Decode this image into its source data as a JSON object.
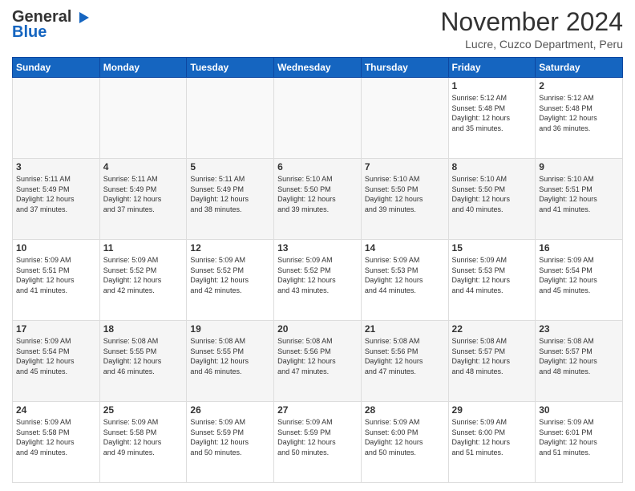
{
  "header": {
    "logo_line1": "General",
    "logo_line2": "Blue",
    "month_title": "November 2024",
    "location": "Lucre, Cuzco Department, Peru"
  },
  "days_of_week": [
    "Sunday",
    "Monday",
    "Tuesday",
    "Wednesday",
    "Thursday",
    "Friday",
    "Saturday"
  ],
  "weeks": [
    [
      {
        "day": "",
        "info": ""
      },
      {
        "day": "",
        "info": ""
      },
      {
        "day": "",
        "info": ""
      },
      {
        "day": "",
        "info": ""
      },
      {
        "day": "",
        "info": ""
      },
      {
        "day": "1",
        "info": "Sunrise: 5:12 AM\nSunset: 5:48 PM\nDaylight: 12 hours\nand 35 minutes."
      },
      {
        "day": "2",
        "info": "Sunrise: 5:12 AM\nSunset: 5:48 PM\nDaylight: 12 hours\nand 36 minutes."
      }
    ],
    [
      {
        "day": "3",
        "info": "Sunrise: 5:11 AM\nSunset: 5:49 PM\nDaylight: 12 hours\nand 37 minutes."
      },
      {
        "day": "4",
        "info": "Sunrise: 5:11 AM\nSunset: 5:49 PM\nDaylight: 12 hours\nand 37 minutes."
      },
      {
        "day": "5",
        "info": "Sunrise: 5:11 AM\nSunset: 5:49 PM\nDaylight: 12 hours\nand 38 minutes."
      },
      {
        "day": "6",
        "info": "Sunrise: 5:10 AM\nSunset: 5:50 PM\nDaylight: 12 hours\nand 39 minutes."
      },
      {
        "day": "7",
        "info": "Sunrise: 5:10 AM\nSunset: 5:50 PM\nDaylight: 12 hours\nand 39 minutes."
      },
      {
        "day": "8",
        "info": "Sunrise: 5:10 AM\nSunset: 5:50 PM\nDaylight: 12 hours\nand 40 minutes."
      },
      {
        "day": "9",
        "info": "Sunrise: 5:10 AM\nSunset: 5:51 PM\nDaylight: 12 hours\nand 41 minutes."
      }
    ],
    [
      {
        "day": "10",
        "info": "Sunrise: 5:09 AM\nSunset: 5:51 PM\nDaylight: 12 hours\nand 41 minutes."
      },
      {
        "day": "11",
        "info": "Sunrise: 5:09 AM\nSunset: 5:52 PM\nDaylight: 12 hours\nand 42 minutes."
      },
      {
        "day": "12",
        "info": "Sunrise: 5:09 AM\nSunset: 5:52 PM\nDaylight: 12 hours\nand 42 minutes."
      },
      {
        "day": "13",
        "info": "Sunrise: 5:09 AM\nSunset: 5:52 PM\nDaylight: 12 hours\nand 43 minutes."
      },
      {
        "day": "14",
        "info": "Sunrise: 5:09 AM\nSunset: 5:53 PM\nDaylight: 12 hours\nand 44 minutes."
      },
      {
        "day": "15",
        "info": "Sunrise: 5:09 AM\nSunset: 5:53 PM\nDaylight: 12 hours\nand 44 minutes."
      },
      {
        "day": "16",
        "info": "Sunrise: 5:09 AM\nSunset: 5:54 PM\nDaylight: 12 hours\nand 45 minutes."
      }
    ],
    [
      {
        "day": "17",
        "info": "Sunrise: 5:09 AM\nSunset: 5:54 PM\nDaylight: 12 hours\nand 45 minutes."
      },
      {
        "day": "18",
        "info": "Sunrise: 5:08 AM\nSunset: 5:55 PM\nDaylight: 12 hours\nand 46 minutes."
      },
      {
        "day": "19",
        "info": "Sunrise: 5:08 AM\nSunset: 5:55 PM\nDaylight: 12 hours\nand 46 minutes."
      },
      {
        "day": "20",
        "info": "Sunrise: 5:08 AM\nSunset: 5:56 PM\nDaylight: 12 hours\nand 47 minutes."
      },
      {
        "day": "21",
        "info": "Sunrise: 5:08 AM\nSunset: 5:56 PM\nDaylight: 12 hours\nand 47 minutes."
      },
      {
        "day": "22",
        "info": "Sunrise: 5:08 AM\nSunset: 5:57 PM\nDaylight: 12 hours\nand 48 minutes."
      },
      {
        "day": "23",
        "info": "Sunrise: 5:08 AM\nSunset: 5:57 PM\nDaylight: 12 hours\nand 48 minutes."
      }
    ],
    [
      {
        "day": "24",
        "info": "Sunrise: 5:09 AM\nSunset: 5:58 PM\nDaylight: 12 hours\nand 49 minutes."
      },
      {
        "day": "25",
        "info": "Sunrise: 5:09 AM\nSunset: 5:58 PM\nDaylight: 12 hours\nand 49 minutes."
      },
      {
        "day": "26",
        "info": "Sunrise: 5:09 AM\nSunset: 5:59 PM\nDaylight: 12 hours\nand 50 minutes."
      },
      {
        "day": "27",
        "info": "Sunrise: 5:09 AM\nSunset: 5:59 PM\nDaylight: 12 hours\nand 50 minutes."
      },
      {
        "day": "28",
        "info": "Sunrise: 5:09 AM\nSunset: 6:00 PM\nDaylight: 12 hours\nand 50 minutes."
      },
      {
        "day": "29",
        "info": "Sunrise: 5:09 AM\nSunset: 6:00 PM\nDaylight: 12 hours\nand 51 minutes."
      },
      {
        "day": "30",
        "info": "Sunrise: 5:09 AM\nSunset: 6:01 PM\nDaylight: 12 hours\nand 51 minutes."
      }
    ]
  ]
}
